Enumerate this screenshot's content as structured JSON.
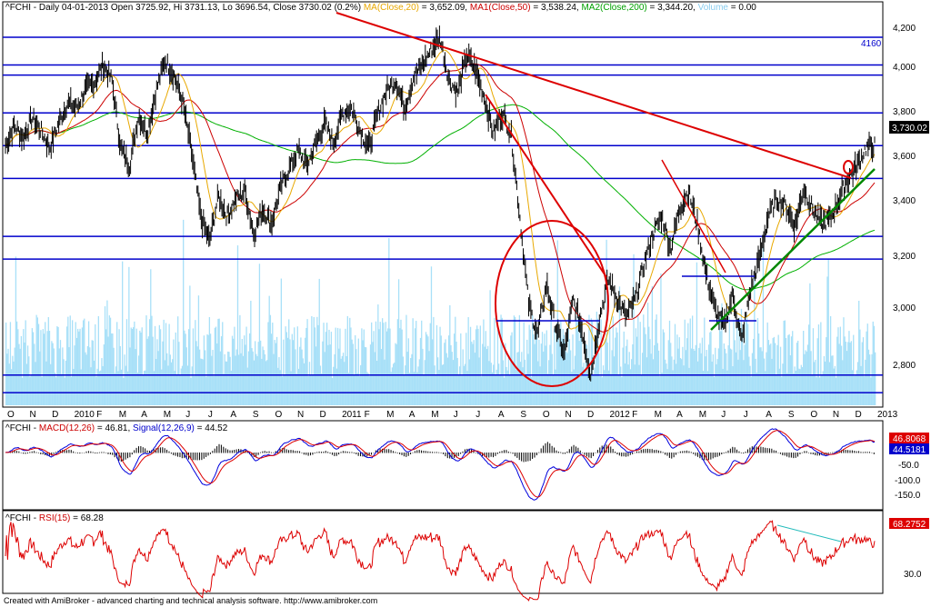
{
  "main": {
    "symbol": "^FCHI",
    "header_prefix": "^FCHI - Daily 04-01-2013 Open 3725.92, Hi 3731.13, Lo 3696.54, Close 3730.02 (0.2%)",
    "ma20_label": "MA(Close,20)",
    "ma20_value": "= 3,652.09,",
    "ma50_label": "MA1(Close,50)",
    "ma50_value": "= 3,538.24,",
    "ma200_label": "MA2(Close,200)",
    "ma200_value": "= 3,344.20,",
    "volume_label": "Volume",
    "volume_value": "= 0.00",
    "y_ticks": [
      "4,200",
      "4,000",
      "3,800",
      "3,600",
      "3,400",
      "3,200",
      "3,000",
      "2,800"
    ],
    "last_price": "3,730.02",
    "level_label": "4160",
    "x_labels": [
      "O",
      "N",
      "D",
      "2010",
      "F",
      "M",
      "A",
      "M",
      "J",
      "J",
      "A",
      "S",
      "O",
      "N",
      "D",
      "2011",
      "F",
      "M",
      "A",
      "M",
      "J",
      "J",
      "A",
      "S",
      "O",
      "N",
      "D",
      "2012",
      "F",
      "M",
      "A",
      "M",
      "J",
      "J",
      "A",
      "S",
      "O",
      "N",
      "D",
      "2013"
    ]
  },
  "macd": {
    "label_prefix": "^FCHI - ",
    "macd_label": "MACD(12,26)",
    "macd_value": "= 46.81,",
    "signal_label": "Signal(12,26,9)",
    "signal_value": "= 44.52",
    "y_ticks": [
      "-50.0",
      "-100.0",
      "-150.0"
    ],
    "macd_last": "46.8068",
    "signal_last": "44.5181"
  },
  "rsi": {
    "label_prefix": "^FCHI - ",
    "rsi_label": "RSI(15)",
    "rsi_value": "= 68.28",
    "y_ticks": [
      "30.0"
    ],
    "rsi_last": "68.2752"
  },
  "footer": "Created with AmiBroker - advanced charting and technical analysis software. http://www.amibroker.com",
  "colors": {
    "ma20": "#e8a800",
    "ma50": "#cc0000",
    "ma200": "#00b000",
    "volume": "#a8e0f8",
    "hline": "#0000cc",
    "trend": "#dd0000",
    "support": "#008800",
    "macd": "#0000dd",
    "signal": "#dd0000",
    "rsi": "#dd0000"
  },
  "chart_data": {
    "type": "line",
    "title": "^FCHI Daily",
    "y_range": [
      2700,
      4250
    ],
    "x_start": "2009-10",
    "x_end": "2013-01",
    "price_series": [
      3730,
      3810,
      3760,
      3840,
      3790,
      3720,
      3820,
      3900,
      3880,
      3950,
      3980,
      4050,
      3990,
      3720,
      3650,
      3850,
      3780,
      3950,
      4070,
      4010,
      3900,
      3700,
      3450,
      3350,
      3530,
      3450,
      3520,
      3550,
      3380,
      3480,
      3420,
      3560,
      3640,
      3710,
      3650,
      3740,
      3820,
      3740,
      3860,
      3880,
      3790,
      3720,
      3860,
      3950,
      3990,
      3880,
      4000,
      4050,
      4110,
      4160,
      3990,
      3940,
      4090,
      4030,
      3920,
      3780,
      3860,
      3780,
      3450,
      3100,
      2980,
      3180,
      3020,
      2900,
      3120,
      3000,
      2820,
      3050,
      3200,
      3120,
      3050,
      3120,
      3260,
      3380,
      3450,
      3320,
      3480,
      3550,
      3420,
      3220,
      3080,
      3010,
      3140,
      2950,
      3160,
      3280,
      3450,
      3520,
      3490,
      3410,
      3560,
      3480,
      3420,
      3440,
      3520,
      3600,
      3650,
      3720,
      3730
    ],
    "horizontal_levels": [
      4160,
      4050,
      4010,
      3860,
      3730,
      3600,
      3370,
      3280,
      2820,
      2750
    ],
    "ma20_last": 3652.09,
    "ma50_last": 3538.24,
    "ma200_last": 3344.2,
    "macd_last": 46.81,
    "signal_last": 44.52,
    "rsi_last": 68.28
  }
}
